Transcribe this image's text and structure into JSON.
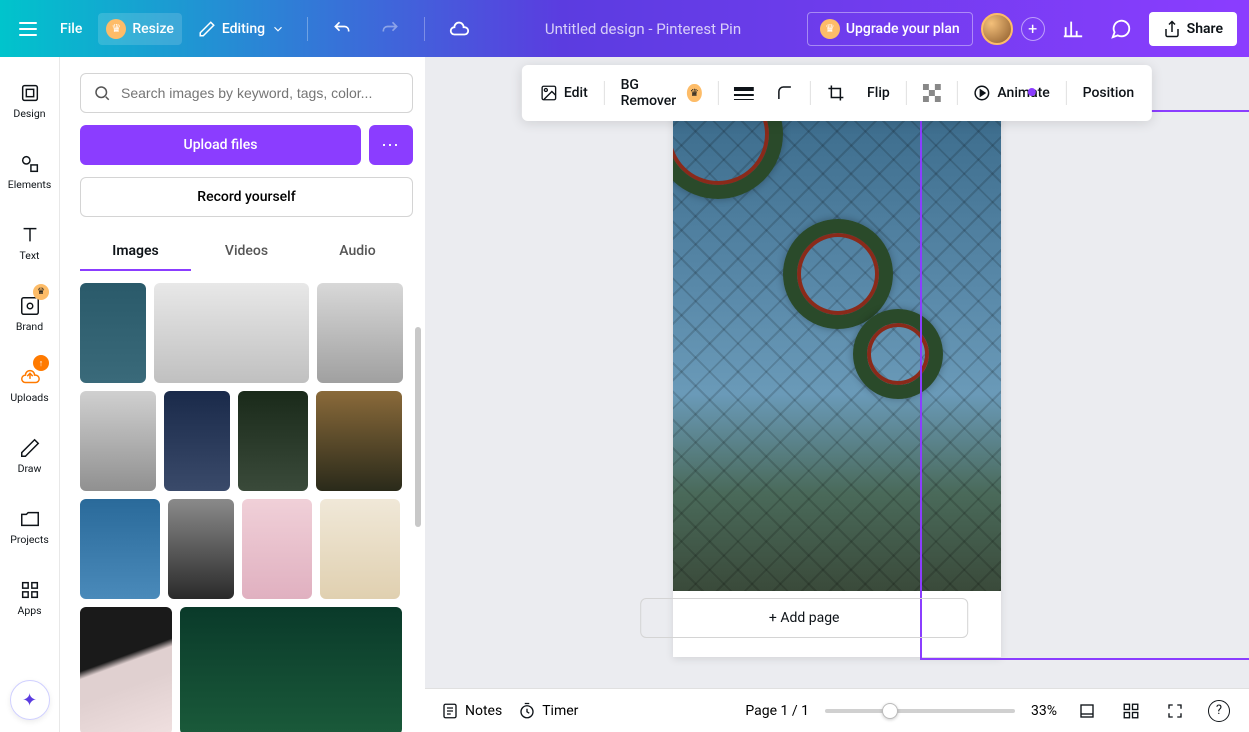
{
  "topbar": {
    "file": "File",
    "resize": "Resize",
    "editing": "Editing",
    "doc_title": "Untitled design - Pinterest Pin",
    "upgrade": "Upgrade your plan",
    "share": "Share"
  },
  "rail": {
    "design": "Design",
    "elements": "Elements",
    "text": "Text",
    "brand": "Brand",
    "uploads": "Uploads",
    "draw": "Draw",
    "projects": "Projects",
    "apps": "Apps"
  },
  "panel": {
    "search_placeholder": "Search images by keyword, tags, color...",
    "upload": "Upload files",
    "record": "Record yourself",
    "tabs": {
      "images": "Images",
      "videos": "Videos",
      "audio": "Audio"
    }
  },
  "context": {
    "edit": "Edit",
    "bg_remover": "BG Remover",
    "flip": "Flip",
    "animate": "Animate",
    "position": "Position"
  },
  "canvas": {
    "add_page": "+ Add page"
  },
  "bottom": {
    "notes": "Notes",
    "timer": "Timer",
    "page_counter": "Page 1 / 1",
    "zoom": "33%"
  }
}
